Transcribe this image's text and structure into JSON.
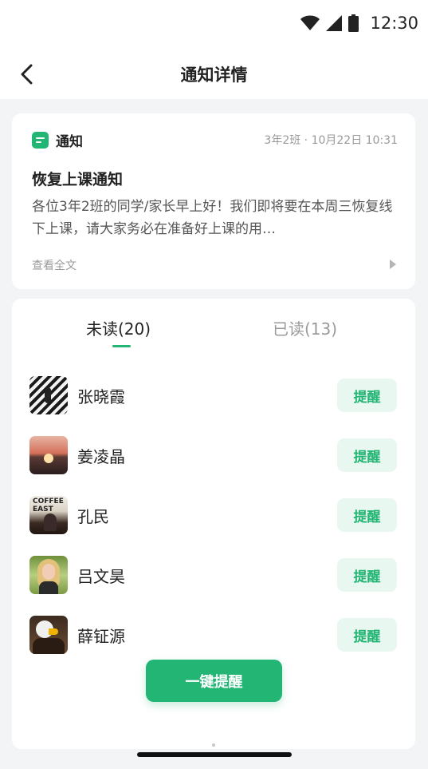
{
  "status_bar": {
    "time": "12:30",
    "icons": [
      "wifi-icon",
      "signal-icon",
      "battery-icon"
    ]
  },
  "header": {
    "title": "通知详情",
    "back_icon": "back-chevron-icon"
  },
  "notice": {
    "tag_label": "通知",
    "tag_icon": "notice-doc-icon",
    "meta": "3年2班 · 10月22日 10:31",
    "title": "恢复上课通知",
    "body": "各位3年2班的同学/家长早上好！我们即将要在本周三恢复线下上课，请大家务必在准备好上课的用…",
    "more_label": "查看全文",
    "more_icon": "chevron-right-icon"
  },
  "tabs": [
    {
      "label": "未读(20)",
      "active": true
    },
    {
      "label": "已读(13)",
      "active": false
    }
  ],
  "unread_list": [
    {
      "name": "张晓霞",
      "button": "提醒"
    },
    {
      "name": "姜凌晶",
      "button": "提醒"
    },
    {
      "name": "孔民",
      "button": "提醒"
    },
    {
      "name": "吕文昊",
      "button": "提醒"
    },
    {
      "name": "薛钲源",
      "button": "提醒"
    }
  ],
  "avatar_3_text": "COFFEE\nEAST",
  "remind_all_label": "一键提醒",
  "colors": {
    "accent": "#22b573",
    "accent_light": "#e8f7ef",
    "background": "#f3f4f6",
    "card": "#ffffff"
  }
}
